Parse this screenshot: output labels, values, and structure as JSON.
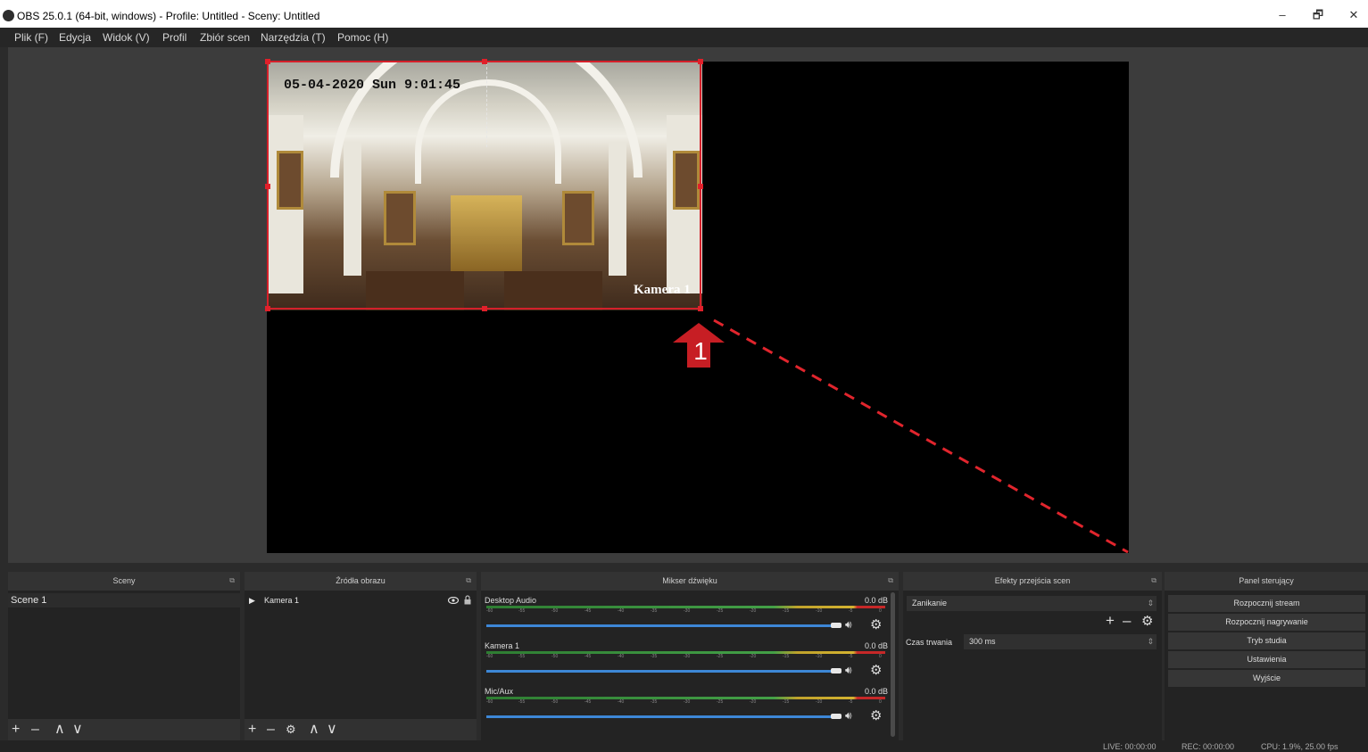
{
  "window": {
    "title": "OBS 25.0.1 (64-bit, windows) - Profile: Untitled - Sceny: Untitled",
    "minimize": "–",
    "maximize": "🗗",
    "close": "✕"
  },
  "menu": [
    {
      "label": "Plik (F)"
    },
    {
      "label": "Edycja"
    },
    {
      "label": "Widok (V)"
    },
    {
      "label": "Profil"
    },
    {
      "label": "Zbiór scen"
    },
    {
      "label": "Narzędzia (T)"
    },
    {
      "label": "Pomoc (H)"
    }
  ],
  "preview": {
    "camera_timestamp": "05-04-2020 Sun 9:01:45",
    "camera_label": "Kamera 1",
    "callout_number": "1"
  },
  "docks": {
    "scenes": {
      "title": "Sceny",
      "items": [
        "Scene 1"
      ],
      "footer_icons": [
        "+",
        "–",
        "∧",
        "∨"
      ]
    },
    "sources": {
      "title": "Źródła obrazu",
      "items": [
        {
          "play": "▶",
          "name": "Kamera 1"
        }
      ],
      "footer_icons": [
        "+",
        "–",
        "⚙",
        "∧",
        "∨"
      ]
    },
    "mixer": {
      "title": "Mikser dźwięku",
      "channels": [
        {
          "name": "Desktop Audio",
          "db": "0.0 dB"
        },
        {
          "name": "Kamera 1",
          "db": "0.0 dB"
        },
        {
          "name": "Mic/Aux",
          "db": "0.0 dB"
        }
      ],
      "scale": [
        "-60",
        "-55",
        "-50",
        "-45",
        "-40",
        "-35",
        "-30",
        "-25",
        "-20",
        "-15",
        "-10",
        "-5",
        "0"
      ]
    },
    "transitions": {
      "title": "Efekty przejścia scen",
      "selected": "Zanikanie",
      "duration_label": "Czas trwania",
      "duration_value": "300 ms"
    },
    "controls": {
      "title": "Panel sterujący",
      "buttons": [
        "Rozpocznij stream",
        "Rozpocznij nagrywanie",
        "Tryb studia",
        "Ustawienia",
        "Wyjście"
      ]
    }
  },
  "status": {
    "live": "LIVE: 00:00:00",
    "rec": "REC: 00:00:00",
    "cpu": "CPU: 1.9%, 25.00 fps"
  }
}
